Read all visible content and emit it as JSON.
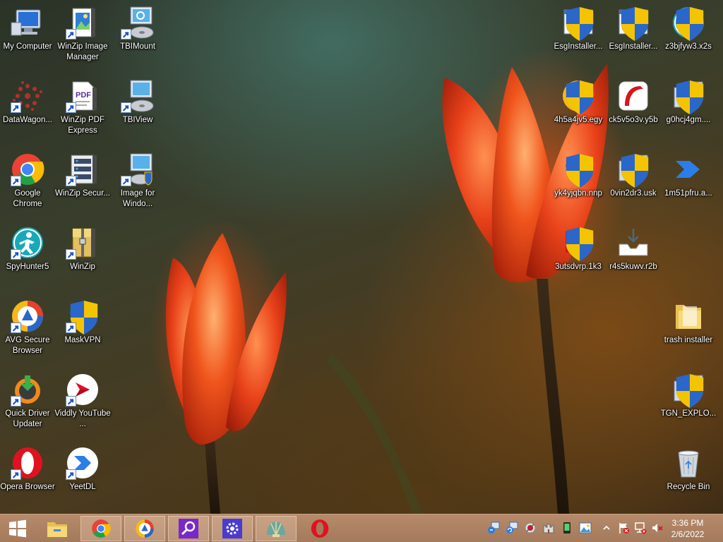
{
  "desktop": {
    "icons": [
      {
        "label": "My Computer"
      },
      {
        "label": "WinZip Image Manager"
      },
      {
        "label": "TBIMount"
      },
      {
        "label": "DataWagon..."
      },
      {
        "label": "WinZip PDF Express"
      },
      {
        "label": "TBIView"
      },
      {
        "label": "Google Chrome"
      },
      {
        "label": "WinZip Secur..."
      },
      {
        "label": "Image for Windo..."
      },
      {
        "label": "SpyHunter5"
      },
      {
        "label": "WinZip"
      },
      {
        "label": "AVG Secure Browser"
      },
      {
        "label": "MaskVPN"
      },
      {
        "label": "Quick Driver Updater"
      },
      {
        "label": "Viddly YouTube ..."
      },
      {
        "label": "Opera Browser"
      },
      {
        "label": "YeetDL"
      },
      {
        "label": "EsgInstaller..."
      },
      {
        "label": "EsgInstaller..."
      },
      {
        "label": "z3bjfyw3.x2s"
      },
      {
        "label": "4h5a4jv5.egy"
      },
      {
        "label": "ck5v5o3v.y5b"
      },
      {
        "label": "g0hcj4gm...."
      },
      {
        "label": "yk4yjqbn.nnp"
      },
      {
        "label": "0vin2dr3.usk"
      },
      {
        "label": "1m51pfru.a..."
      },
      {
        "label": "3utsdvrp.1k3"
      },
      {
        "label": "r4s5kuwv.r2b"
      },
      {
        "label": "trash installer"
      },
      {
        "label": "TGN_EXPLO..."
      },
      {
        "label": "Recycle Bin"
      }
    ]
  },
  "taskbar": {
    "clock": {
      "time": "3:36 PM",
      "date": "2/6/2022"
    }
  },
  "colors": {
    "taskbar": "#a47a5c",
    "taskbar_active": "#c8a48a",
    "tulip": "#e8451a",
    "opera_red": "#e0121f",
    "chrome_green": "#21a045",
    "chrome_yellow": "#fbbc04",
    "chrome_red": "#ea4335",
    "chrome_blue": "#4285f4",
    "winzip_purple": "#5a2ca0"
  }
}
